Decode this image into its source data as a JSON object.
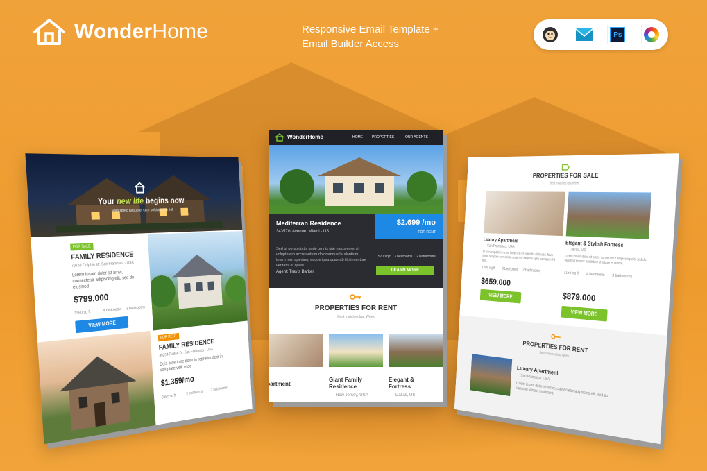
{
  "header": {
    "brand_bold": "Wonder",
    "brand_light": "Home",
    "tagline_line1": "Responsive Email Template +",
    "tagline_line2": "Email Builder Access",
    "tool_icons": [
      "mailchimp-icon",
      "campaign-monitor-icon",
      "photoshop-icon",
      "color-wheel-icon"
    ],
    "photoshop_label": "Ps"
  },
  "colors": {
    "bg": "#f0a130",
    "green": "#7cc22b",
    "blue": "#1e88e5",
    "orange": "#f39200",
    "dark": "#1f2126"
  },
  "left": {
    "hero_title_pre": "Your ",
    "hero_title_em": "new life",
    "hero_title_post": " begins now",
    "hero_sub": "Nam libero tempore, cum soluta nobis est",
    "p1_tag": "FOR SALE",
    "p1_title": "FAMILY RESIDENCE",
    "p1_address": "79758 Dolphin str. San Francisco - USA",
    "p1_desc": "Lorem ipsum dolor sit amet, consectetur adipiscing elit, sed do eiusmod",
    "p1_price": "$799.000",
    "p1_area": "1580 sq ft",
    "p1_beds": "4 bedrooms",
    "p1_baths": "3 bathrooms",
    "p1_btn": "VIEW MORE",
    "p2_tag": "FOR RENT",
    "p2_title": "FAMILY RESIDENCE",
    "p2_address": "40204 Rodeo Dr. San Francisco - USA",
    "p2_desc": "Duis aute irure dolor in reprehenderit in voluptate velit esse",
    "p2_price": "$1.359/mo",
    "p2_area": "3155 sq ft",
    "p2_beds": "3 bedrooms",
    "p2_baths": "2 bathrooms"
  },
  "mid": {
    "brand": "WonderHome",
    "nav": [
      "HOME",
      "PROPERTIES",
      "OUR AGENTS"
    ],
    "listing_title": "Mediterran Residence",
    "listing_address": "34357th Avenue, Miami - US",
    "price": "$2.699 /mo",
    "price_sub": "FOR RENT",
    "desc": "Sed ut perspiciatis unde omnis iste natus error sit voluptatem accusantium doloremque laudantium, totam rem aperiam, eaque ipsa quae ab illo inventore veritatis et quasi...",
    "agent": "Agent: Travis Barker",
    "area": "1520 sq ft",
    "beds": "3 bedrooms",
    "baths": "2 bathrooms",
    "btn": "LEARN MORE",
    "section_title": "PROPERTIES FOR RENT",
    "section_sub": "Best matches last Week",
    "tile1": "Luxury Apartment",
    "tile2_line1": "Giant Family",
    "tile2_line2": "Residence",
    "tile2_loc": "New Jersey, USA",
    "tile3_line1": "Elegant &",
    "tile3_line2": "Fortress",
    "tile3_loc": "Dallas, US"
  },
  "right": {
    "section1_title": "PROPERTIES FOR SALE",
    "section1_sub": "Best matches last Week",
    "p1_title": "Luxury Apartment",
    "p1_loc": "San Francisco, USA",
    "p1_desc": "Et harum quidem rerum facilis est et expedita distinctio. Nam libero tempore cum soluta nobis est eligendi optio cumque nihil quo.",
    "p1_area": "1580 sq ft",
    "p1_beds": "3 bedrooms",
    "p1_baths": "2 bathrooms",
    "p1_price": "$659.000",
    "p1_btn": "VIEW MORE",
    "p2_title": "Elegant & Stylish Fortress",
    "p2_loc": "Dallas, US",
    "p2_desc": "Lorem ipsum dolor sit amet, consectetur adipiscing elit, sed do eiusmod tempor incididunt ut labore et dolore.",
    "p2_area": "3155 sq ft",
    "p2_beds": "4 bedrooms",
    "p2_baths": "3 bathrooms",
    "p2_price": "$879.000",
    "p2_btn": "VIEW MORE",
    "section2_title": "PROPERTIES FOR RENT",
    "section2_sub": "Best matches last Week",
    "p3_title": "Luxury Apartment",
    "p3_loc": "San Francisco, USA",
    "p3_desc": "Lorem ipsum dolor sit amet, consectetur adipiscing elit, sed do eiusmod tempor incididunt."
  }
}
